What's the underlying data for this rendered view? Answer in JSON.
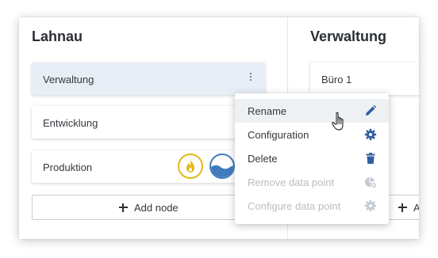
{
  "left_column": {
    "title": "Lahnau",
    "nodes": [
      {
        "label": "Verwaltung",
        "selected": true
      },
      {
        "label": "Entwicklung"
      },
      {
        "label": "Produktion",
        "badges": [
          "fire-icon",
          "water-icon"
        ]
      }
    ],
    "add_node_label": "Add node"
  },
  "right_column": {
    "title": "Verwaltung",
    "nodes": [
      {
        "label": "Büro 1"
      }
    ],
    "add_node_label": "A"
  },
  "context_menu": {
    "items": [
      {
        "label": "Rename",
        "icon": "pencil-icon",
        "disabled": false,
        "hovered": true
      },
      {
        "label": "Configuration",
        "icon": "gear-icon",
        "disabled": false
      },
      {
        "label": "Delete",
        "icon": "trash-icon",
        "disabled": false
      },
      {
        "label": "Remove data point",
        "icon": "remove-datapoint-icon",
        "disabled": true
      },
      {
        "label": "Configure data point",
        "icon": "gear-icon",
        "disabled": true
      }
    ]
  },
  "colors": {
    "accent": "#2f5f9e",
    "fire_badge": "#e3b818",
    "water_badge": "#3f7bbd",
    "selected_bg": "#e8eef6",
    "disabled_text": "#b9bdc2"
  }
}
